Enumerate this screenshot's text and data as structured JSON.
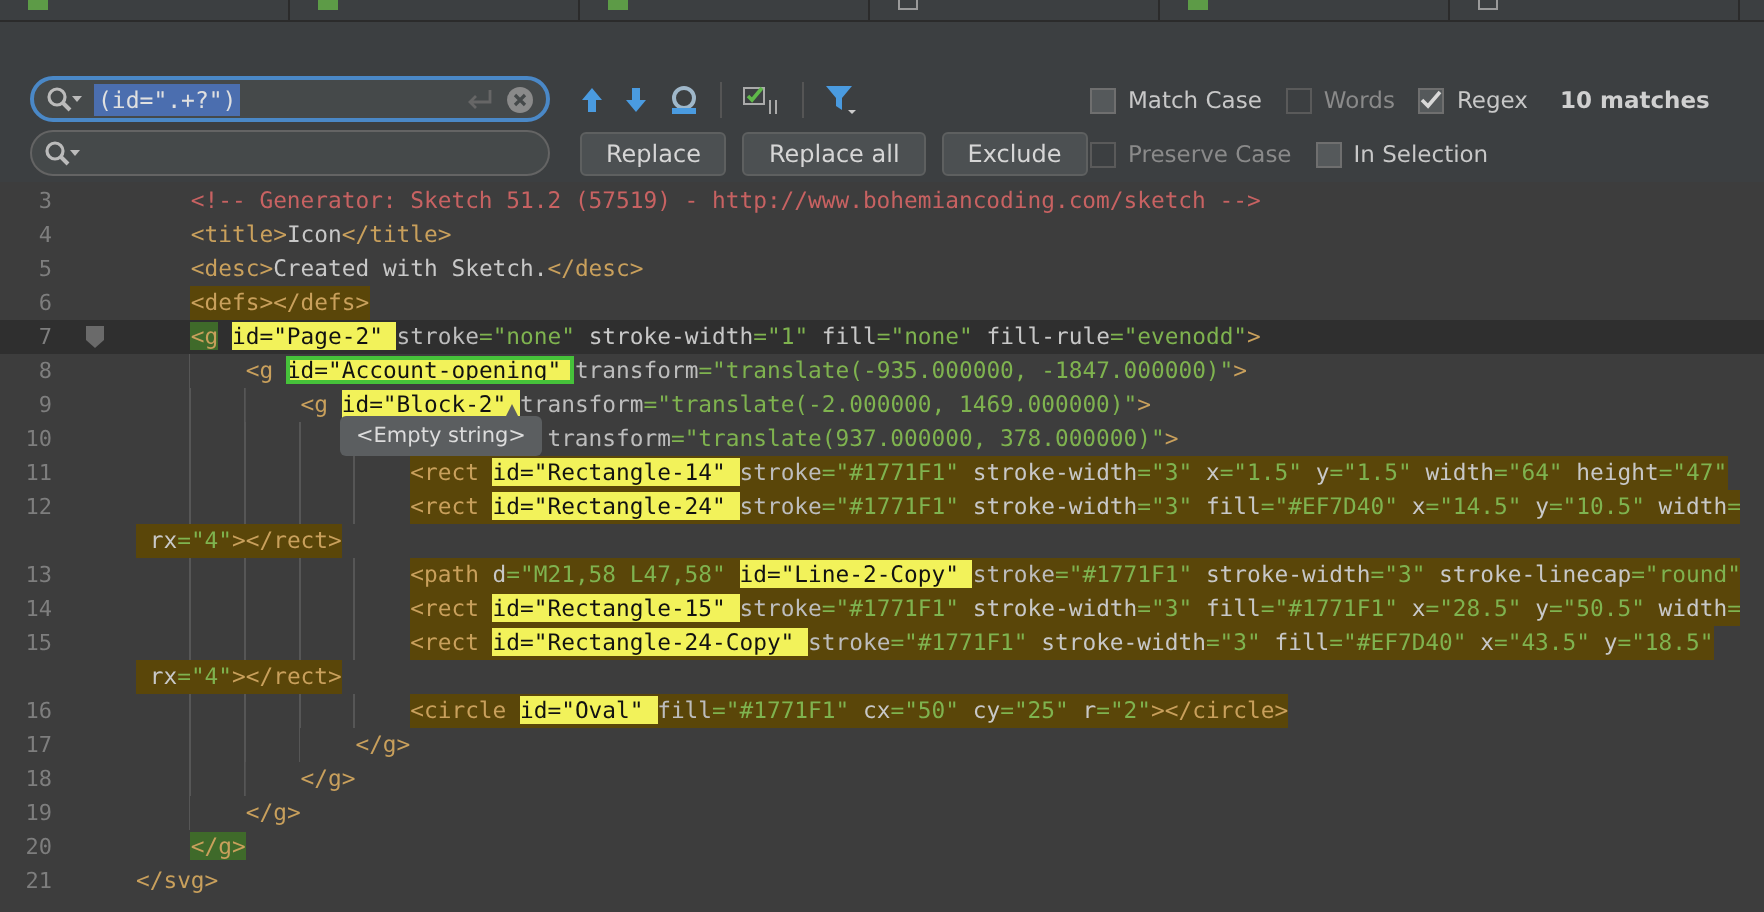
{
  "tabs": [
    {
      "kind": "image"
    },
    {
      "kind": "image"
    },
    {
      "kind": "image"
    },
    {
      "kind": "text"
    },
    {
      "kind": "image"
    },
    {
      "kind": "text"
    }
  ],
  "find_bar": {
    "search_field": {
      "value": "(id=\".+?\")",
      "focused": true,
      "value_selected": true
    },
    "replace_field": {
      "focused": false
    },
    "toolbar": [
      {
        "kind": "previous"
      },
      {
        "kind": "next"
      },
      {
        "kind": "find-all"
      },
      {
        "kind": "select-all"
      },
      {
        "kind": "filter"
      }
    ],
    "buttons": [
      "Replace",
      "Replace all",
      "Exclude"
    ],
    "options_row_1": [
      {
        "label": "Match Case",
        "checked": false,
        "disabled": false
      },
      {
        "label": "Words",
        "checked": false,
        "disabled": true
      },
      {
        "label": "Regex",
        "checked": true,
        "disabled": false
      }
    ],
    "match_count": "10 matches",
    "options_row_2": [
      {
        "label": "Preserve Case",
        "checked": false,
        "disabled": true
      },
      {
        "label": "In Selection",
        "checked": false,
        "disabled": false
      }
    ]
  },
  "editor": {
    "lines": [
      {
        "kind": "line",
        "number": "3",
        "scoped": false,
        "current": false,
        "fold": false,
        "segments": [
          {
            "kind": "code",
            "text": "    <!-- Generator: Sketch 51.2 (57519) - http://www.bohemiancoding.com/sketch -->"
          }
        ]
      },
      {
        "kind": "line",
        "number": "4",
        "scoped": false,
        "current": false,
        "fold": false,
        "segments": [
          {
            "kind": "code",
            "text": "    <title>Icon</title>"
          }
        ]
      },
      {
        "kind": "line",
        "number": "5",
        "scoped": false,
        "current": false,
        "fold": false,
        "segments": [
          {
            "kind": "code",
            "text": "    <desc>Created with Sketch.</desc>"
          }
        ]
      },
      {
        "kind": "line",
        "number": "6",
        "scoped": true,
        "current": false,
        "fold": false,
        "segments": [
          {
            "kind": "code",
            "text": "    <defs></defs>"
          }
        ]
      },
      {
        "kind": "line",
        "number": "7",
        "scoped": false,
        "current": true,
        "fold": true,
        "segments": [
          {
            "kind": "brace",
            "text": "    <g "
          },
          {
            "kind": "match",
            "text": "id=\"Page-2\" "
          },
          {
            "kind": "code",
            "text": "stroke=\"none\" stroke-width=\"1\" fill=\"none\" fill-rule=\"evenodd\">"
          }
        ]
      },
      {
        "kind": "line",
        "number": "8",
        "scoped": false,
        "current": false,
        "fold": false,
        "segments": [
          {
            "kind": "code",
            "text": "        <g "
          },
          {
            "kind": "current-match",
            "text": "id=\"Account-opening\" "
          },
          {
            "kind": "code",
            "text": "transform=\"translate(-935.000000, -1847.000000)\">"
          }
        ]
      },
      {
        "kind": "line",
        "number": "9",
        "scoped": false,
        "current": false,
        "fold": false,
        "segments": [
          {
            "kind": "code",
            "text": "            <g "
          },
          {
            "kind": "match",
            "text": "id=\"Block-2\" "
          },
          {
            "kind": "code",
            "text": "transform=\"translate(-2.000000, 1469.000000)\">"
          }
        ]
      },
      {
        "kind": "line",
        "number": "10",
        "scoped": false,
        "current": false,
        "fold": false,
        "segments": [
          {
            "kind": "code",
            "text": "                              transform=\"translate(937.000000, 378.000000)\">"
          }
        ]
      },
      {
        "kind": "line",
        "number": "11",
        "scoped": true,
        "current": false,
        "fold": false,
        "segments": [
          {
            "kind": "code",
            "text": "                    <rect "
          },
          {
            "kind": "match",
            "text": "id=\"Rectangle-14\" "
          },
          {
            "kind": "code",
            "text": "stroke=\"#1771F1\" stroke-width=\"3\" x=\"1.5\" y=\"1.5\" width=\"64\" height=\"47\""
          }
        ]
      },
      {
        "kind": "line",
        "number": "12",
        "scoped": true,
        "current": false,
        "fold": false,
        "segments": [
          {
            "kind": "code",
            "text": "                    <rect "
          },
          {
            "kind": "match",
            "text": "id=\"Rectangle-24\" "
          },
          {
            "kind": "code",
            "text": "stroke=\"#1771F1\" stroke-width=\"3\" fill=\"#EF7D40\" x=\"14.5\" y=\"10.5\" width="
          }
        ]
      },
      {
        "kind": "continuation",
        "scoped": true,
        "current": false,
        "fold": false,
        "segments": [
          {
            "kind": "code",
            "text": " rx=\"4\"></rect>"
          }
        ]
      },
      {
        "kind": "line",
        "number": "13",
        "scoped": true,
        "current": false,
        "fold": false,
        "segments": [
          {
            "kind": "code",
            "text": "                    <path d=\"M21,58 L47,58\" "
          },
          {
            "kind": "match",
            "text": "id=\"Line-2-Copy\" "
          },
          {
            "kind": "code",
            "text": "stroke=\"#1771F1\" stroke-width=\"3\" stroke-linecap=\"round\""
          }
        ]
      },
      {
        "kind": "line",
        "number": "14",
        "scoped": true,
        "current": false,
        "fold": false,
        "segments": [
          {
            "kind": "code",
            "text": "                    <rect "
          },
          {
            "kind": "match",
            "text": "id=\"Rectangle-15\" "
          },
          {
            "kind": "code",
            "text": "stroke=\"#1771F1\" stroke-width=\"3\" fill=\"#1771F1\" x=\"28.5\" y=\"50.5\" width="
          }
        ]
      },
      {
        "kind": "line",
        "number": "15",
        "scoped": true,
        "current": false,
        "fold": false,
        "segments": [
          {
            "kind": "code",
            "text": "                    <rect "
          },
          {
            "kind": "match",
            "text": "id=\"Rectangle-24-Copy\" "
          },
          {
            "kind": "code",
            "text": "stroke=\"#1771F1\" stroke-width=\"3\" fill=\"#EF7D40\" x=\"43.5\" y=\"18.5\""
          }
        ]
      },
      {
        "kind": "continuation",
        "scoped": true,
        "current": false,
        "fold": false,
        "segments": [
          {
            "kind": "code",
            "text": " rx=\"4\"></rect>"
          }
        ]
      },
      {
        "kind": "line",
        "number": "16",
        "scoped": true,
        "current": false,
        "fold": false,
        "segments": [
          {
            "kind": "code",
            "text": "                    <circle "
          },
          {
            "kind": "match",
            "text": "id=\"Oval\" "
          },
          {
            "kind": "code",
            "text": "fill=\"#1771F1\" cx=\"50\" cy=\"25\" r=\"2\"></circle>"
          }
        ]
      },
      {
        "kind": "line",
        "number": "17",
        "scoped": false,
        "current": false,
        "fold": false,
        "segments": [
          {
            "kind": "code",
            "text": "                </g>"
          }
        ]
      },
      {
        "kind": "line",
        "number": "18",
        "scoped": false,
        "current": false,
        "fold": false,
        "segments": [
          {
            "kind": "code",
            "text": "            </g>"
          }
        ]
      },
      {
        "kind": "line",
        "number": "19",
        "scoped": false,
        "current": false,
        "fold": false,
        "segments": [
          {
            "kind": "code",
            "text": "        </g>"
          }
        ]
      },
      {
        "kind": "line",
        "number": "20",
        "scoped": false,
        "current": false,
        "fold": false,
        "segments": [
          {
            "kind": "brace",
            "text": "    </g>"
          }
        ]
      },
      {
        "kind": "line",
        "number": "21",
        "scoped": false,
        "current": false,
        "fold": false,
        "segments": [
          {
            "kind": "code",
            "text": "</svg>"
          }
        ]
      }
    ],
    "tooltip": {
      "text": "<Empty string>"
    }
  }
}
